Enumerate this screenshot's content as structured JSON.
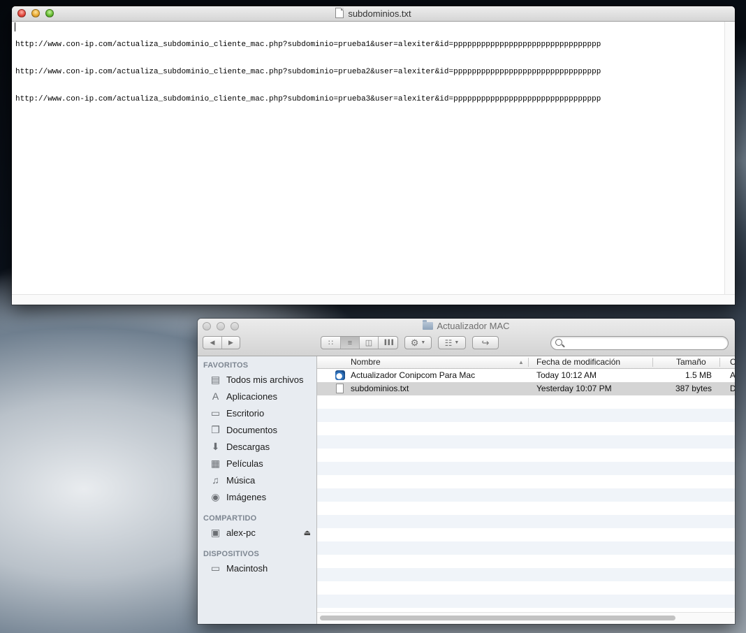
{
  "textedit": {
    "title": "subdominios.txt",
    "lines": [
      "http://www.con-ip.com/actualiza_subdominio_cliente_mac.php?subdominio=prueba1&user=alexiter&id=pppppppppppppppppppppppppppppppp",
      "http://www.con-ip.com/actualiza_subdominio_cliente_mac.php?subdominio=prueba2&user=alexiter&id=pppppppppppppppppppppppppppppppp",
      "http://www.con-ip.com/actualiza_subdominio_cliente_mac.php?subdominio=prueba3&user=alexiter&id=pppppppppppppppppppppppppppppppp"
    ]
  },
  "finder": {
    "title": "Actualizador MAC",
    "toolbar": {
      "back_icon": "◀",
      "forward_icon": "▶",
      "view_icons": [
        "∷",
        "≡",
        "◫",
        "▐▐▐"
      ],
      "action_icon": "⚙",
      "arrange_icon": "☷",
      "share_icon": "↪",
      "search_placeholder": ""
    },
    "sidebar": {
      "favoritos_header": "FAVORITOS",
      "favoritos": [
        {
          "label": "Todos mis archivos",
          "icon": "all-files-icon",
          "glyph": "▤"
        },
        {
          "label": "Aplicaciones",
          "icon": "applications-icon",
          "glyph": "A"
        },
        {
          "label": "Escritorio",
          "icon": "desktop-icon",
          "glyph": "▭"
        },
        {
          "label": "Documentos",
          "icon": "documents-icon",
          "glyph": "❐"
        },
        {
          "label": "Descargas",
          "icon": "downloads-icon",
          "glyph": "⬇"
        },
        {
          "label": "Películas",
          "icon": "movies-icon",
          "glyph": "▦"
        },
        {
          "label": "Música",
          "icon": "music-icon",
          "glyph": "♫"
        },
        {
          "label": "Imágenes",
          "icon": "pictures-icon",
          "glyph": "◉"
        }
      ],
      "compartido_header": "COMPARTIDO",
      "compartido": [
        {
          "label": "alex-pc",
          "icon": "computer-icon",
          "glyph": "▣"
        }
      ],
      "eject_icon": "⏏",
      "dispositivos_header": "DISPOSITIVOS",
      "dispositivos": [
        {
          "label": "Macintosh",
          "icon": "hard-disk-icon",
          "glyph": "▭"
        }
      ]
    },
    "columns": {
      "name": "Nombre",
      "sort_indicator": "▲",
      "date": "Fecha de modificación",
      "size": "Tamaño",
      "kind": "C"
    },
    "files": [
      {
        "name": "Actualizador Conipcom  Para Mac",
        "date": "Today 10:12 AM",
        "size": "1.5 MB",
        "kind": "A",
        "icon": "app-icon"
      },
      {
        "name": "subdominios.txt",
        "date": "Yesterday 10:07 PM",
        "size": "387 bytes",
        "kind": "D",
        "icon": "text-file-icon"
      }
    ]
  }
}
